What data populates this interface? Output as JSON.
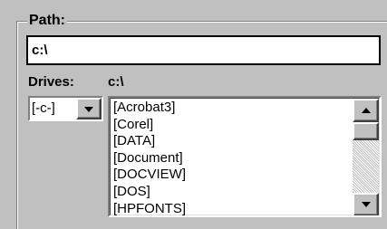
{
  "path_group": {
    "label": "Path:",
    "value": "c:\\"
  },
  "drives": {
    "label": "Drives:",
    "selected": "[-c-]"
  },
  "directory": {
    "label": "c:\\",
    "items": [
      "[Acrobat3]",
      "[Corel]",
      "[DATA]",
      "[Document]",
      "[DOCVIEW]",
      "[DOS]",
      "[HPFONTS]"
    ]
  },
  "icons": {
    "drive_dropdown": "chevron-down-icon",
    "scroll_up": "arrow-up-icon",
    "scroll_down": "arrow-down-icon"
  },
  "colors": {
    "face": "#c0c0c0",
    "field": "#ffffff",
    "text": "#000000"
  }
}
